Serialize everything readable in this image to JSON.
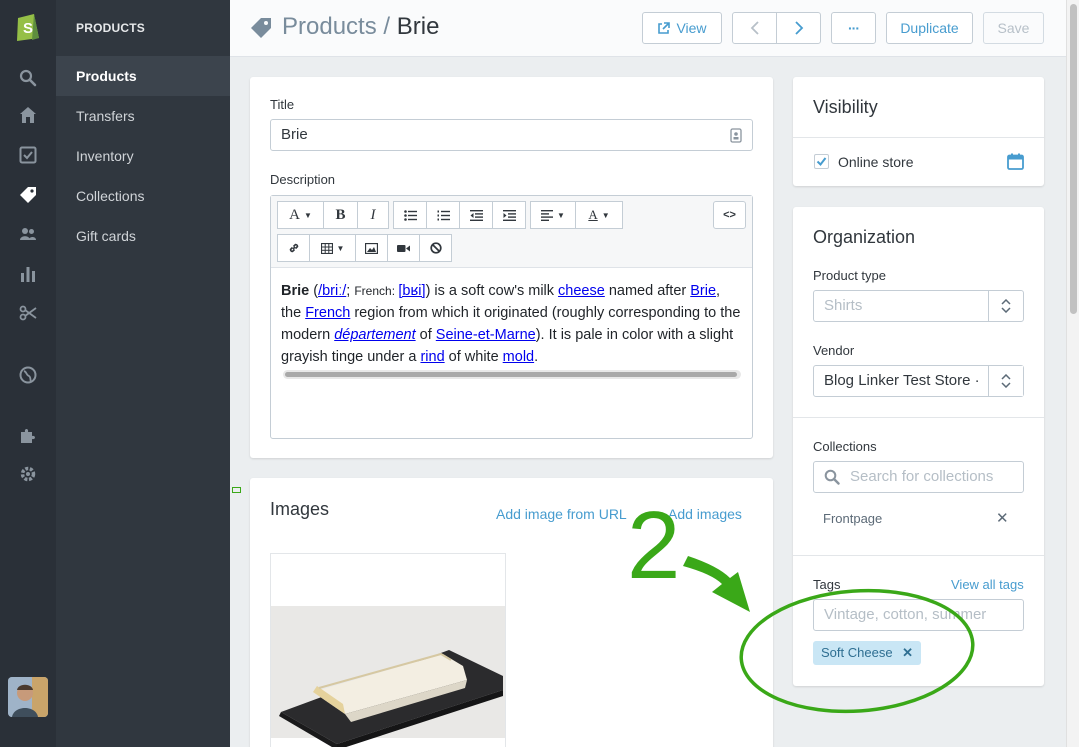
{
  "nav": {
    "section_heading": "PRODUCTS",
    "items": [
      {
        "label": "Products",
        "active": true
      },
      {
        "label": "Transfers",
        "active": false
      },
      {
        "label": "Inventory",
        "active": false
      },
      {
        "label": "Collections",
        "active": false
      },
      {
        "label": "Gift cards",
        "active": false
      }
    ],
    "rail_icons": [
      "shopify-logo-icon",
      "search-icon",
      "home-icon",
      "orders-icon",
      "products-tag-icon",
      "customers-icon",
      "reports-icon",
      "discounts-icon",
      "online-store-globe-icon",
      "apps-puzzle-icon",
      "settings-gear-icon"
    ]
  },
  "header": {
    "breadcrumb_parent": "Products",
    "separator": "/",
    "title": "Brie",
    "view_label": "View",
    "more_label": "···",
    "duplicate_label": "Duplicate",
    "save_label": "Save"
  },
  "product": {
    "title_label": "Title",
    "title_value": "Brie",
    "description_label": "Description",
    "toolbar": {
      "font_label": "A",
      "bold_label": "B",
      "italic_label": "I",
      "html_label": "<>"
    },
    "description": {
      "name": "Brie",
      "pron_open": " (",
      "pron": "/briː/",
      "semi": "; ",
      "french_label": "French: ",
      "ipa": "[bʁi]",
      "p1": ") is a soft cow's milk ",
      "cheese": "cheese",
      "p2": " named after ",
      "brie_link": "Brie",
      "p3": ", the ",
      "french_link": "French",
      "p4": " region from which it originated (roughly corresponding to the modern ",
      "departement": "département",
      "p5": " of ",
      "seine": "Seine-et-Marne",
      "p6": "). It is pale in color with a slight grayish tinge under a ",
      "rind": "rind",
      "p7": " of white ",
      "mold": "mold",
      "p8": "."
    }
  },
  "images": {
    "title": "Images",
    "add_from_url": "Add image from URL",
    "add_images": "Add images"
  },
  "visibility": {
    "title": "Visibility",
    "online_store_label": "Online store",
    "online_store_checked": true
  },
  "organization": {
    "title": "Organization",
    "product_type_label": "Product type",
    "product_type_placeholder": "Shirts",
    "vendor_label": "Vendor",
    "vendor_value": "Blog Linker Test Store ·",
    "collections_label": "Collections",
    "collections_placeholder": "Search for collections",
    "collections": [
      "Frontpage"
    ],
    "tags_label": "Tags",
    "view_all_tags": "View all tags",
    "tags_placeholder": "Vintage, cotton, summer",
    "tags": [
      "Soft Cheese"
    ]
  },
  "annotation": {
    "number": "2",
    "color": "#3aa818"
  },
  "colors": {
    "accent": "#479ccf",
    "nav_dark": "#2a3038",
    "subnav": "#30373f",
    "tag_chip": "#c9e6f5"
  }
}
